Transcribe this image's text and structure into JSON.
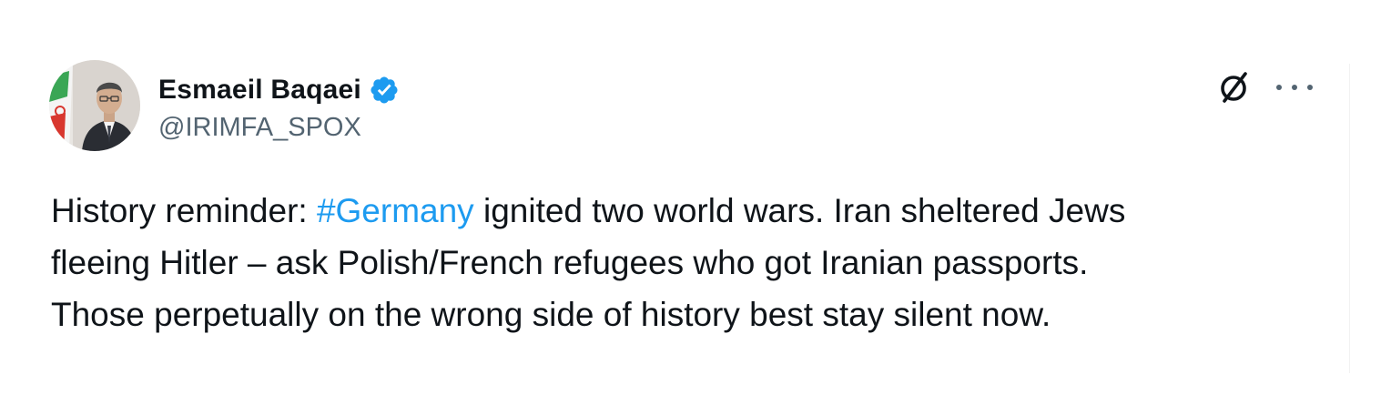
{
  "author": {
    "display_name": "Esmaeil Baqaei",
    "handle": "@IRIMFA_SPOX",
    "verified": true,
    "verified_color": "#1d9bf0"
  },
  "actions": {
    "grok_icon": "slashed-circle-icon",
    "more_icon": "more-options-icon"
  },
  "tweet": {
    "line1_before": "History reminder: ",
    "hashtag": "#Germany",
    "line1_after": " ignited two world wars. Iran sheltered Jews",
    "line2": "fleeing Hitler – ask Polish/French refugees who got Iranian passports.",
    "line3": "Those perpetually on the wrong side of history best stay silent now."
  },
  "colors": {
    "text": "#0f1419",
    "secondary": "#536471",
    "link": "#1d9bf0"
  }
}
